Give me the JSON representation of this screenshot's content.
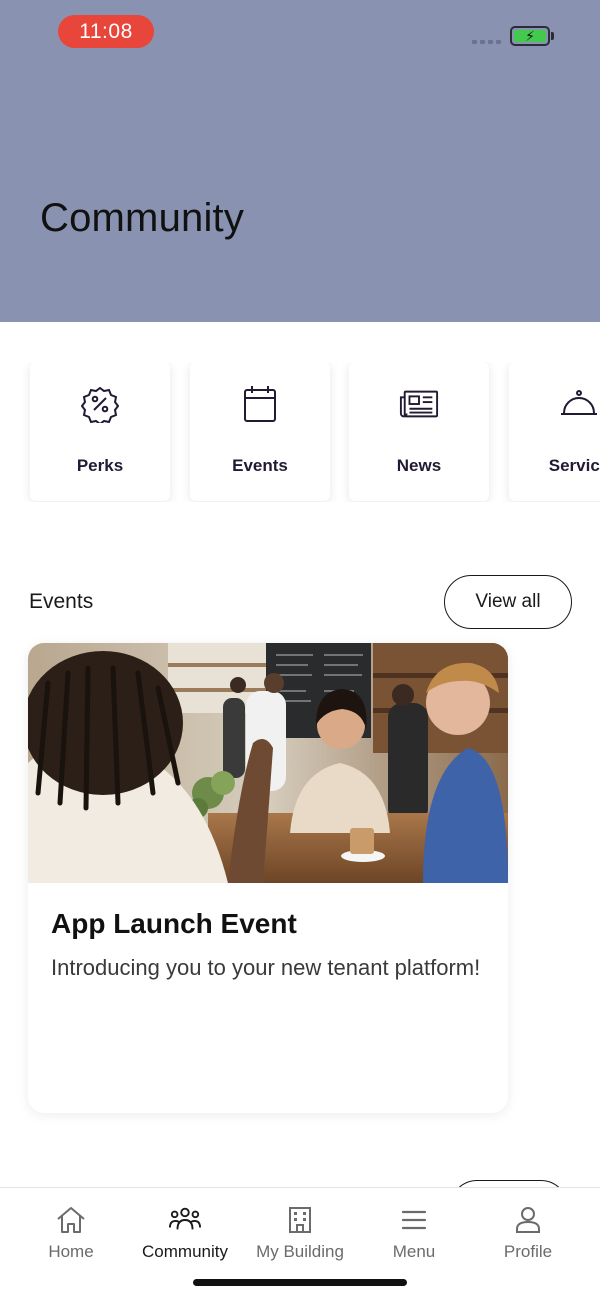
{
  "status_bar": {
    "time": "11:08",
    "colors": {
      "time_pill": "#e8463a",
      "battery": "#44c94f"
    }
  },
  "header": {
    "title": "Community",
    "background": "#8993b1"
  },
  "quick_links": [
    {
      "label": "Perks",
      "icon": "perks-badge-icon"
    },
    {
      "label": "Events",
      "icon": "calendar-icon"
    },
    {
      "label": "News",
      "icon": "newspaper-icon"
    },
    {
      "label": "Service",
      "icon": "service-bell-icon"
    }
  ],
  "events_section": {
    "heading": "Events",
    "view_all_label": "View all",
    "cards": [
      {
        "title": "App Launch Event",
        "description": "Introducing you to your new tenant platform!",
        "image": "cafe-people-photo"
      }
    ]
  },
  "tab_bar": {
    "active": "Community",
    "tabs": [
      {
        "label": "Home",
        "icon": "home-icon"
      },
      {
        "label": "Community",
        "icon": "community-icon"
      },
      {
        "label": "My Building",
        "icon": "building-icon"
      },
      {
        "label": "Menu",
        "icon": "menu-icon"
      },
      {
        "label": "Profile",
        "icon": "profile-icon"
      }
    ]
  }
}
